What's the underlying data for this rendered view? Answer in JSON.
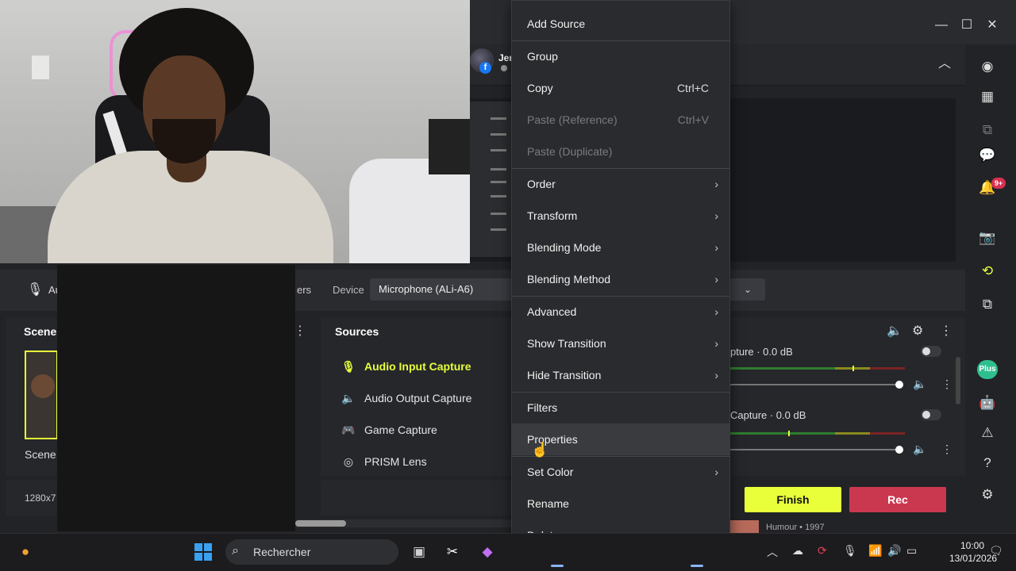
{
  "window": {
    "minimize_glyph": "—",
    "maximize_glyph": "☐",
    "close_glyph": "✕"
  },
  "profile": {
    "name": "Jer",
    "badge": "f"
  },
  "audio_toolbar": {
    "source_abbrev": "Au",
    "filters_fragment": "ers",
    "device_label": "Device",
    "device_value": "Microphone (ALi-A6)"
  },
  "scenes": {
    "title": "Scenes",
    "items": [
      {
        "label": "Scene"
      }
    ],
    "resolution": "1280x7"
  },
  "sources": {
    "title": "Sources",
    "items": [
      {
        "label": "Audio Input Capture",
        "icon": "microphone-icon",
        "active": true
      },
      {
        "label": "Audio Output Capture",
        "icon": "speaker-icon",
        "active": false
      },
      {
        "label": "Game Capture",
        "icon": "gamepad-icon",
        "active": false
      },
      {
        "label": "PRISM Lens",
        "icon": "camera-lens-icon",
        "active": false
      }
    ]
  },
  "mixer": {
    "channels": [
      {
        "label": "pture · 0.0 dB",
        "level": 0.7
      },
      {
        "label": "Capture · 0.0 dB",
        "level": 0.33
      }
    ]
  },
  "controls": {
    "finish_label": "Finish",
    "rec_label": "Rec"
  },
  "now_playing": "Humour • 1997",
  "sidebar": {
    "notification_count": "9+",
    "plus_label": "Plus"
  },
  "context_menu": {
    "items": [
      {
        "label": "Add Source",
        "shortcut": "",
        "submenu": false,
        "disabled": false
      },
      {
        "label": "Group",
        "shortcut": "",
        "submenu": false,
        "disabled": false
      },
      {
        "label": "Copy",
        "shortcut": "Ctrl+C",
        "submenu": false,
        "disabled": false
      },
      {
        "label": "Paste (Reference)",
        "shortcut": "Ctrl+V",
        "submenu": false,
        "disabled": true
      },
      {
        "label": "Paste (Duplicate)",
        "shortcut": "",
        "submenu": false,
        "disabled": true
      },
      {
        "label": "Order",
        "shortcut": "",
        "submenu": true,
        "disabled": false
      },
      {
        "label": "Transform",
        "shortcut": "",
        "submenu": true,
        "disabled": false
      },
      {
        "label": "Blending Mode",
        "shortcut": "",
        "submenu": true,
        "disabled": false
      },
      {
        "label": "Blending Method",
        "shortcut": "",
        "submenu": true,
        "disabled": false
      },
      {
        "label": "Advanced",
        "shortcut": "",
        "submenu": true,
        "disabled": false
      },
      {
        "label": "Show Transition",
        "shortcut": "",
        "submenu": true,
        "disabled": false
      },
      {
        "label": "Hide Transition",
        "shortcut": "",
        "submenu": true,
        "disabled": false
      },
      {
        "label": "Filters",
        "shortcut": "",
        "submenu": false,
        "disabled": false
      },
      {
        "label": "Properties",
        "shortcut": "",
        "submenu": false,
        "disabled": false,
        "hovered": true
      },
      {
        "label": "Set Color",
        "shortcut": "",
        "submenu": true,
        "disabled": false
      },
      {
        "label": "Rename",
        "shortcut": "",
        "submenu": false,
        "disabled": false
      },
      {
        "label": "Delete",
        "shortcut": "",
        "submenu": false,
        "disabled": false
      }
    ]
  },
  "taskbar": {
    "search_placeholder": "Rechercher",
    "time": "10:00",
    "date": "13/01/2026"
  },
  "colors": {
    "accent": "#e8ff3a",
    "rec": "#c9384f",
    "menu_bg": "#2a2b2e"
  }
}
